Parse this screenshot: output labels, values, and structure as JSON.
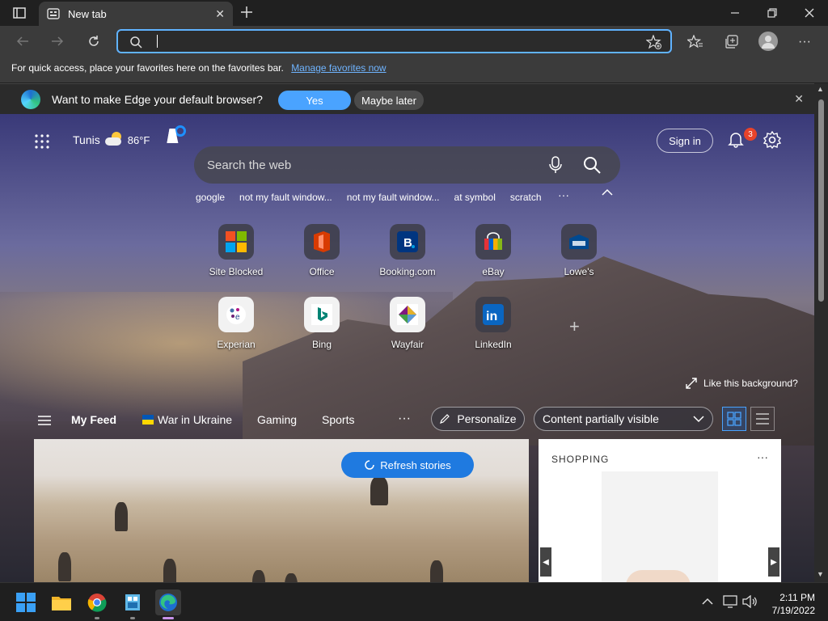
{
  "browser": {
    "tab_title": "New tab",
    "address_value": "",
    "favbar_message": "For quick access, place your favorites here on the favorites bar.",
    "favbar_link": "Manage favorites now",
    "default_prompt": "Want to make Edge your default browser?",
    "default_yes": "Yes",
    "default_later": "Maybe later"
  },
  "newtab": {
    "city": "Tunis",
    "temperature": "86°F",
    "sign_in": "Sign in",
    "notification_count": "3",
    "search_placeholder": "Search the web",
    "trending": [
      "google",
      "not my fault window...",
      "not my fault window...",
      "at symbol",
      "scratch"
    ],
    "trending_more": "···",
    "tiles": [
      {
        "label": "Site Blocked"
      },
      {
        "label": "Office"
      },
      {
        "label": "Booking.com"
      },
      {
        "label": "eBay"
      },
      {
        "label": "Lowe's"
      },
      {
        "label": "Experian"
      },
      {
        "label": "Bing"
      },
      {
        "label": "Wayfair"
      },
      {
        "label": "LinkedIn"
      }
    ],
    "like_background": "Like this background?"
  },
  "feed": {
    "tabs": [
      "My Feed",
      "War in Ukraine",
      "Gaming",
      "Sports"
    ],
    "more": "···",
    "personalize": "Personalize",
    "content_visibility": "Content partially visible",
    "refresh": "Refresh stories",
    "shopping_header": "SHOPPING",
    "shopping_more": "···"
  },
  "taskbar": {
    "time": "2:11 PM",
    "date": "7/19/2022"
  },
  "colors": {
    "accent": "#4aa3ff",
    "refresh": "#1f7ae0",
    "badge": "#e8432a",
    "link": "#6fb4ff"
  }
}
